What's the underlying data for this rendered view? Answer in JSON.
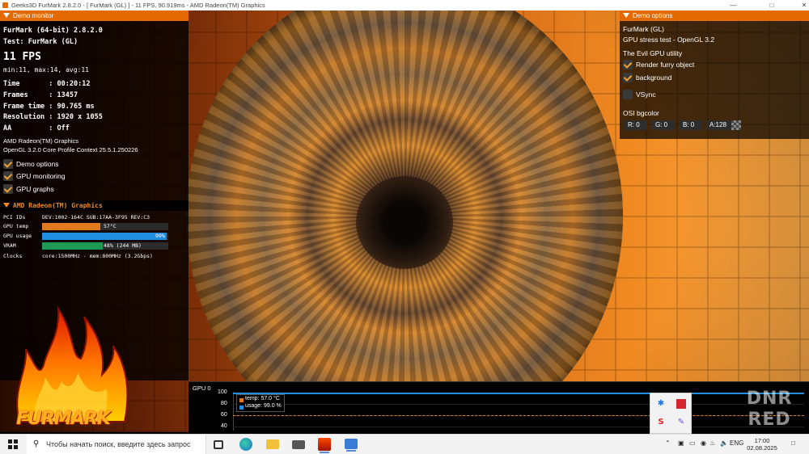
{
  "window": {
    "title": "Geeks3D FurMark 2.8.2.0 - [ FurMark (GL) ] - 11 FPS, 90.919ms - AMD Radeon(TM) Graphics",
    "minimize_icon": "minimize-icon",
    "maximize_icon": "maximize-icon",
    "close_icon": "close-icon"
  },
  "demo_monitor": {
    "header": "Demo monitor",
    "app_name": "FurMark (64-bit) 2.8.2.0",
    "test": "Test: FurMark (GL)",
    "fps": "11 FPS",
    "fps_range": "min:11, max:14, avg:11",
    "stats": [
      {
        "label": "Time       ",
        "value": ": 00:20:12"
      },
      {
        "label": "Frames     ",
        "value": ": 13457"
      },
      {
        "label": "Frame time ",
        "value": ": 90.765 ms"
      },
      {
        "label": "Resolution ",
        "value": ": 1920 x 1055"
      },
      {
        "label": "AA         ",
        "value": ": Off"
      }
    ],
    "renderer": "AMD Radeon(TM) Graphics",
    "gl_context": "OpenGL 3.2.0 Core Profile Context 25.5.1.250226",
    "checkboxes": [
      {
        "label": "Demo options",
        "checked": true
      },
      {
        "label": "GPU monitoring",
        "checked": true
      },
      {
        "label": "GPU graphs",
        "checked": true
      }
    ]
  },
  "gpu_monitor": {
    "header": "AMD Radeon(TM) Graphics",
    "pci_label": "PCI IDs",
    "pci_value": "DEV:1002-164C SUB:17AA-3F95 REV:C3",
    "temp_label": "GPU temp",
    "temp_value": "57°C",
    "temp_fraction": 0.46,
    "usage_label": "GPU usage",
    "usage_value": "99%",
    "usage_fraction": 0.99,
    "vram_label": "VRAM",
    "vram_value": "48% (244 MB)",
    "vram_fraction": 0.48,
    "clocks_label": "Clocks",
    "clocks_value": "core:1500MHz - mem:800MHz (3.2Gbps)",
    "colors": {
      "temp": "#e07a1c",
      "usage": "#1f8de0",
      "vram": "#1e9a55"
    }
  },
  "logo": {
    "text": "FURMARK"
  },
  "demo_options": {
    "header": "Demo options",
    "demo_name": "FurMark (GL)",
    "demo_desc": "GPU stress test - OpenGL 3.2",
    "utility": "The Evil GPU utility",
    "checkboxes": [
      {
        "label": "Render furry object",
        "checked": true
      },
      {
        "label": "background",
        "checked": true
      },
      {
        "label": "VSync",
        "checked": false
      }
    ],
    "osi_label": "OSI bgcolor",
    "color_fields": [
      {
        "label": "R: 0"
      },
      {
        "label": "G: 0"
      },
      {
        "label": "B: 0"
      },
      {
        "label": "A:128"
      }
    ]
  },
  "graph": {
    "title": "GPU 0",
    "y_ticks": [
      "100",
      "80",
      "60",
      "40"
    ],
    "legend_temp": "temp: 57.0 °C",
    "legend_usage": "usage: 99.0 %"
  },
  "watermark": {
    "line1": "DNR",
    "line2": "RED"
  },
  "taskbar": {
    "search_placeholder": "Чтобы начать поиск, введите здесь запрос",
    "language": "ENG",
    "time": "17:00",
    "date": "02.08.2025"
  }
}
